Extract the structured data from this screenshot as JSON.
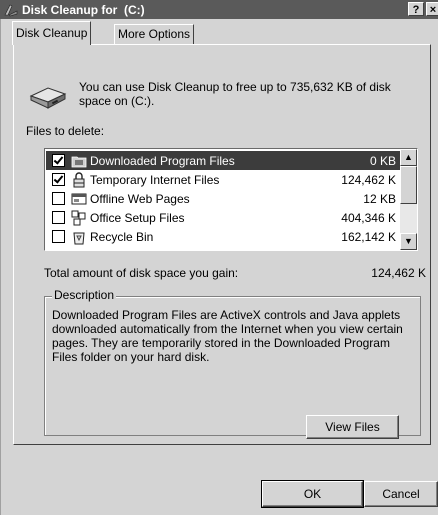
{
  "window": {
    "title": "Disk Cleanup for  (C:)",
    "help_button": "?",
    "close_button": "×"
  },
  "tabs": [
    {
      "label": "Disk Cleanup",
      "active": true
    },
    {
      "label": "More Options",
      "active": false
    }
  ],
  "intro_text": "You can use Disk Cleanup to free up to 735,632 KB of disk space on  (C:).",
  "files_label": "Files to delete:",
  "files": [
    {
      "name": "Downloaded Program Files",
      "size": "0 KB",
      "checked": true,
      "selected": true,
      "icon": "folder-icon"
    },
    {
      "name": "Temporary Internet Files",
      "size": "124,462 K",
      "checked": true,
      "selected": false,
      "icon": "lock-icon"
    },
    {
      "name": "Offline Web Pages",
      "size": "12 KB",
      "checked": false,
      "selected": false,
      "icon": "webpage-icon"
    },
    {
      "name": "Office Setup Files",
      "size": "404,346 K",
      "checked": false,
      "selected": false,
      "icon": "setup-files-icon"
    },
    {
      "name": "Recycle Bin",
      "size": "162,142 K",
      "checked": false,
      "selected": false,
      "icon": "recycle-bin-icon"
    }
  ],
  "total": {
    "label": "Total amount of disk space you gain:",
    "value": "124,462 K"
  },
  "description": {
    "legend": "Description",
    "text": "Downloaded Program Files are ActiveX controls and Java applets downloaded automatically from the Internet when you view certain pages. They are temporarily stored in the Downloaded Program Files folder on your hard disk.",
    "view_files_label": "View Files"
  },
  "buttons": {
    "ok": "OK",
    "cancel": "Cancel"
  },
  "colors": {
    "title_bar": "#5a5a5a",
    "face": "#d4d4d4",
    "selection": "#3c3c3c"
  }
}
